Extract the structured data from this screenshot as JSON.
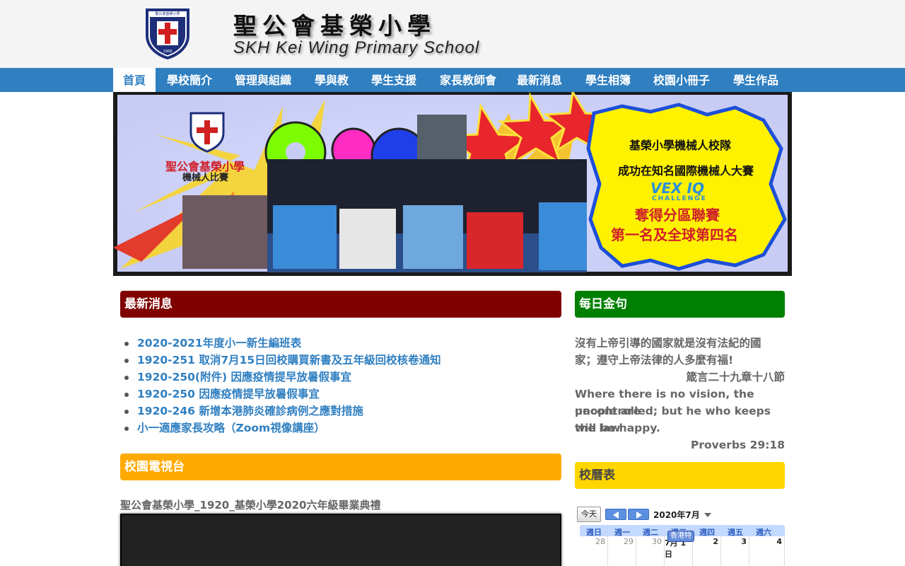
{
  "header": {
    "school_name_zh": "聖公會基榮小學",
    "school_name_en": "SKH Kei Wing Primary School",
    "logo_text": "聖公會基榮小學",
    "logo_year": "1968"
  },
  "nav": {
    "items": [
      {
        "label": "首頁",
        "active": true
      },
      {
        "label": "學校簡介"
      },
      {
        "label": "管理與組織"
      },
      {
        "label": "學與教"
      },
      {
        "label": "學生支援"
      },
      {
        "label": "家長教師會"
      },
      {
        "label": "最新消息"
      },
      {
        "label": "學生相簿"
      },
      {
        "label": "校園小冊子"
      },
      {
        "label": "學生作品"
      }
    ]
  },
  "banner": {
    "school_name": "聖公會基榮小學",
    "event_name": "機械人比賽",
    "headline_1": "基榮小學機械人校隊",
    "headline_2": "成功在知名國際機械人大賽",
    "vex_logo": "VEX IQ",
    "vex_sub": "CHALLENGE",
    "result_1": "奪得分區聯賽",
    "result_2": "第一名及全球第四名"
  },
  "news": {
    "title": "最新消息",
    "items": [
      "2020-2021年度小一新生編班表",
      "1920-251 取消7月15日回校購買新書及五年級回校核卷通知",
      "1920-250(附件) 因應疫情提早放暑假事宜",
      "1920-250 因應疫情提早放暑假事宜",
      "1920-246 新增本港肺炎確診病例之應對措施",
      "小一適應家長攻略（Zoom視像講座）"
    ]
  },
  "tv": {
    "title": "校園電視台",
    "video_title": "聖公會基榮小學_1920_基榮小學2020六年級畢業典禮"
  },
  "verse": {
    "title": "每日金句",
    "zh_line1": "沒有上帝引導的國家就是沒有法紀的國",
    "zh_line2": "家；遵守上帝法律的人多麼有福!",
    "zh_ref": "箴言二十九章十八節",
    "en_line1": "Where there is no vision, the people are",
    "en_line2": "uncontrolled; but he who keeps the law",
    "en_line3": "will be happy.",
    "en_ref": "Proverbs 29:18"
  },
  "calendar": {
    "title": "校曆表",
    "today_label": "今天",
    "month_label": "2020年7月",
    "weekdays": [
      "週日",
      "週一",
      "週二",
      "週三",
      "週四",
      "週五",
      "週六"
    ],
    "days": [
      "28",
      "29",
      "30",
      "7月 1日",
      "2",
      "3",
      "4"
    ],
    "event": "香港特"
  },
  "colors": {
    "nav_bg": "#2f7fc1",
    "news_header": "#800000",
    "tv_header": "#ffaa00",
    "verse_header": "#008000",
    "calendar_header": "#ffd700",
    "link": "#2f7fc1"
  }
}
